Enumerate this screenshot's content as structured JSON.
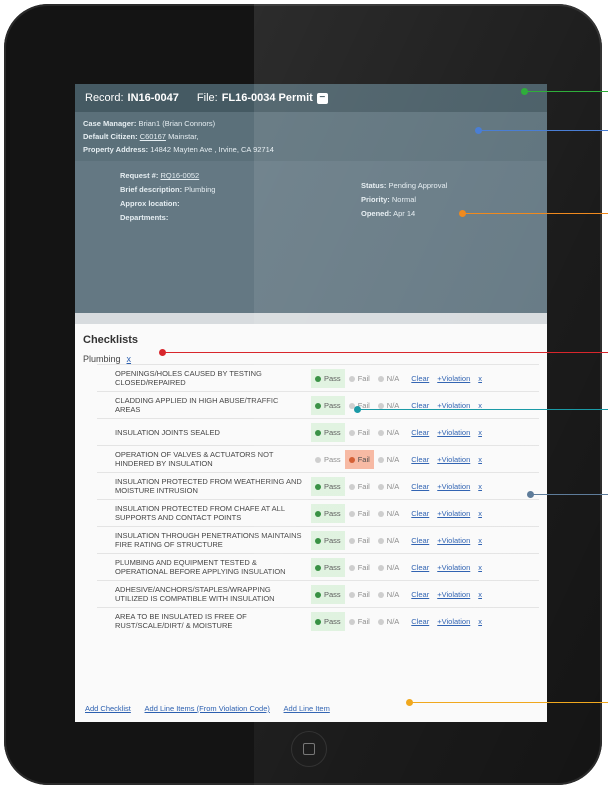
{
  "record": {
    "label": "Record:",
    "value": "IN16-0047",
    "file_label": "File:",
    "file_value": "FL16-0034 Permit",
    "file_icon": "minus-box-icon"
  },
  "info": {
    "case_manager_label": "Case Manager:",
    "case_manager": "Brian1 (Brian Connors)",
    "citizen_label": "Default Citizen:",
    "citizen_id": "C60167",
    "citizen_name": "Mainstar,",
    "address_label": "Property Address:",
    "address": "14842 Mayten Ave , Irvine, CA 92714"
  },
  "request": {
    "req_label": "Request #:",
    "req_value": "RQ16-0052",
    "brief_label": "Brief description:",
    "brief_value": "Plumbing",
    "approx_label": "Approx location:",
    "departments_label": "Departments:",
    "status_label": "Status:",
    "status_value": "Pending Approval",
    "priority_label": "Priority:",
    "priority_value": "Normal",
    "opened_label": "Opened:",
    "opened_value": "Apr 14"
  },
  "checklists": {
    "title": "Checklists",
    "group": "Plumbing",
    "group_remove": "x",
    "options": {
      "pass": "Pass",
      "fail": "Fail",
      "na": "N/A",
      "clear": "Clear",
      "violation": "+Violation",
      "remove": "x"
    },
    "items": [
      {
        "text": "OPENINGS/HOLES CAUSED BY TESTING CLOSED/REPAIRED",
        "selected": "pass"
      },
      {
        "text": "CLADDING APPLIED IN HIGH ABUSE/TRAFFIC AREAS",
        "selected": "pass"
      },
      {
        "text": "INSULATION JOINTS SEALED",
        "selected": "pass"
      },
      {
        "text": "OPERATION OF VALVES & ACTUATORS NOT HINDERED BY INSULATION",
        "selected": "fail"
      },
      {
        "text": "INSULATION PROTECTED FROM WEATHERING AND MOISTURE INTRUSION",
        "selected": "pass"
      },
      {
        "text": "INSULATION PROTECTED FROM CHAFE AT ALL SUPPORTS AND CONTACT POINTS",
        "selected": "pass"
      },
      {
        "text": "INSULATION THROUGH PENETRATIONS MAINTAINS FIRE RATING OF STRUCTURE",
        "selected": "pass"
      },
      {
        "text": "PLUMBING AND EQUIPMENT TESTED & OPERATIONAL BEFORE APPLYING INSULATION",
        "selected": "pass"
      },
      {
        "text": "ADHESIVE/ANCHORS/STAPLES/WRAPPING UTILIZED IS COMPATIBLE WITH INSULATION",
        "selected": "pass"
      },
      {
        "text": "AREA TO BE INSULATED IS FREE OF RUST/SCALE/DIRT/ & MOISTURE",
        "selected": "pass"
      }
    ]
  },
  "footer": {
    "add_checklist": "Add Checklist",
    "add_line_items_code": "Add Line Items (From Violation Code)",
    "add_line_item": "Add Line Item"
  },
  "colors": {
    "green": "#2fae3b",
    "blue": "#4a7ed4",
    "orange": "#f08a1e",
    "red": "#d8262c",
    "teal": "#1a9aa6",
    "slate": "#5e7c9a",
    "amber": "#f0a81e"
  }
}
